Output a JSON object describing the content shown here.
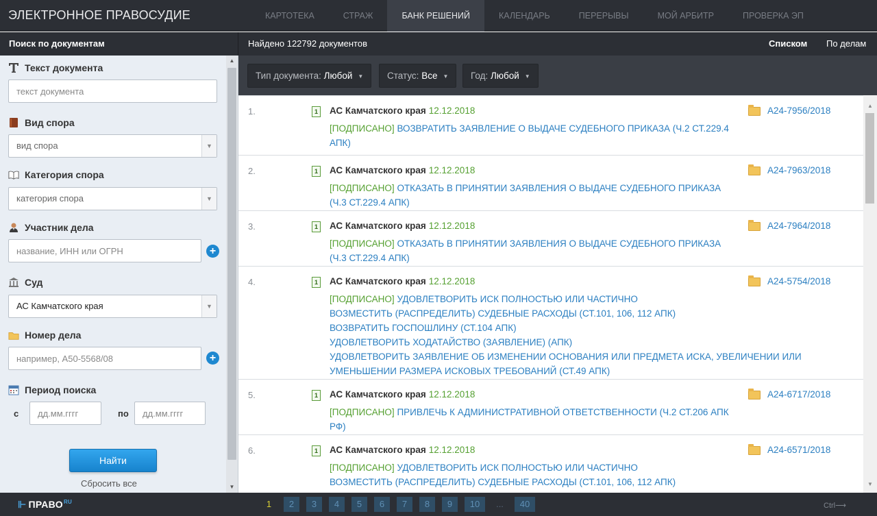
{
  "header": {
    "brand": "ЭЛЕКТРОННОЕ ПРАВОСУДИЕ",
    "nav": [
      {
        "label": "КАРТОТЕКА",
        "active": false
      },
      {
        "label": "СТРАЖ",
        "active": false
      },
      {
        "label": "БАНК РЕШЕНИЙ",
        "active": true
      },
      {
        "label": "КАЛЕНДАРЬ",
        "active": false
      },
      {
        "label": "ПЕРЕРЫВЫ",
        "active": false
      },
      {
        "label": "МОЙ АРБИТР",
        "active": false
      },
      {
        "label": "ПРОВЕРКА ЭП",
        "active": false
      }
    ]
  },
  "search_panel": {
    "title": "Поиск по документам",
    "text": {
      "label": "Текст документа",
      "placeholder": "текст документа",
      "icon": "text-t-icon"
    },
    "dispute_type": {
      "label": "Вид спора",
      "value": "вид спора",
      "icon": "book-brown-icon"
    },
    "dispute_category": {
      "label": "Категория спора",
      "value": "категория спора",
      "icon": "open-book-icon"
    },
    "participant": {
      "label": "Участник дела",
      "placeholder": "название, ИНН или ОГРН",
      "icon": "person-icon"
    },
    "court": {
      "label": "Суд",
      "value": "АС Камчатского края",
      "icon": "courthouse-icon"
    },
    "case_number": {
      "label": "Номер дела",
      "placeholder": "например, А50-5568/08",
      "icon": "folder-icon"
    },
    "period": {
      "label": "Период поиска",
      "from_label": "с",
      "to_label": "по",
      "from_placeholder": "дд.мм.гггг",
      "to_placeholder": "дд.мм.гггг",
      "icon": "calendar-icon"
    },
    "find_button": "Найти",
    "reset_link": "Сбросить все"
  },
  "results_header": {
    "found": "Найдено 122792 документов",
    "view_list": "Списком",
    "view_cases": "По делам"
  },
  "filters": [
    {
      "label": "Тип документа:",
      "value": "Любой"
    },
    {
      "label": "Статус:",
      "value": "Все"
    },
    {
      "label": "Год:",
      "value": "Любой"
    }
  ],
  "results": [
    {
      "num": "1.",
      "court": "АС Камчатского края",
      "date": "12.12.2018",
      "signed": "[ПОДПИСАНО]",
      "lines": [
        "ВОЗВРАТИТЬ ЗАЯВЛЕНИЕ О ВЫДАЧЕ СУДЕБНОГО ПРИКАЗА (Ч.2 СТ.229.4",
        "АПК)"
      ],
      "case": "А24-7956/2018"
    },
    {
      "num": "2.",
      "court": "АС Камчатского края",
      "date": "12.12.2018",
      "signed": "[ПОДПИСАНО]",
      "lines": [
        "ОТКАЗАТЬ В ПРИНЯТИИ ЗАЯВЛЕНИЯ О ВЫДАЧЕ СУДЕБНОГО ПРИКАЗА",
        "(Ч.3 СТ.229.4 АПК)"
      ],
      "case": "А24-7963/2018"
    },
    {
      "num": "3.",
      "court": "АС Камчатского края",
      "date": "12.12.2018",
      "signed": "[ПОДПИСАНО]",
      "lines": [
        "ОТКАЗАТЬ В ПРИНЯТИИ ЗАЯВЛЕНИЯ О ВЫДАЧЕ СУДЕБНОГО ПРИКАЗА",
        "(Ч.3 СТ.229.4 АПК)"
      ],
      "case": "А24-7964/2018"
    },
    {
      "num": "4.",
      "court": "АС Камчатского края",
      "date": "12.12.2018",
      "signed": "[ПОДПИСАНО]",
      "lines": [
        "УДОВЛЕТВОРИТЬ ИСК ПОЛНОСТЬЮ ИЛИ ЧАСТИЧНО",
        "ВОЗМЕСТИТЬ (РАСПРЕДЕЛИТЬ) СУДЕБНЫЕ РАСХОДЫ (СТ.101, 106, 112 АПК)",
        "ВОЗВРАТИТЬ ГОСПОШЛИНУ (СТ.104 АПК)",
        "УДОВЛЕТВОРИТЬ ХОДАТАЙСТВО (ЗАЯВЛЕНИЕ) (АПК)",
        "УДОВЛЕТВОРИТЬ ЗАЯВЛЕНИЕ ОБ ИЗМЕНЕНИИ ОСНОВАНИЯ ИЛИ ПРЕДМЕТА ИСКА, УВЕЛИЧЕНИИ ИЛИ",
        "УМЕНЬШЕНИИ РАЗМЕРА ИСКОВЫХ ТРЕБОВАНИЙ (СТ.49 АПК)"
      ],
      "case": "А24-5754/2018"
    },
    {
      "num": "5.",
      "court": "АС Камчатского края",
      "date": "12.12.2018",
      "signed": "[ПОДПИСАНО]",
      "lines": [
        "ПРИВЛЕЧЬ К АДМИНИСТРАТИВНОЙ ОТВЕТСТВЕННОСТИ (Ч.2 СТ.206 АПК",
        "РФ)"
      ],
      "case": "А24-6717/2018"
    },
    {
      "num": "6.",
      "court": "АС Камчатского края",
      "date": "12.12.2018",
      "signed": "[ПОДПИСАНО]",
      "lines": [
        "УДОВЛЕТВОРИТЬ ИСК ПОЛНОСТЬЮ ИЛИ ЧАСТИЧНО",
        "ВОЗМЕСТИТЬ (РАСПРЕДЕЛИТЬ) СУДЕБНЫЕ РАСХОДЫ (СТ.101, 106, 112 АПК)"
      ],
      "case": "А24-6571/2018"
    }
  ],
  "footer": {
    "logo": "ПРАВО",
    "logo_sup": "RU",
    "pages": [
      "1",
      "2",
      "3",
      "4",
      "5",
      "6",
      "7",
      "8",
      "9",
      "10",
      "...",
      "40"
    ],
    "current_page": "1",
    "ctrl_hint": "Ctrl⟶"
  },
  "colors": {
    "dark_bar": "#2c2f35",
    "link_blue": "#2b7fc1",
    "signed_green": "#55a031",
    "button_blue": "#1e88d0"
  }
}
